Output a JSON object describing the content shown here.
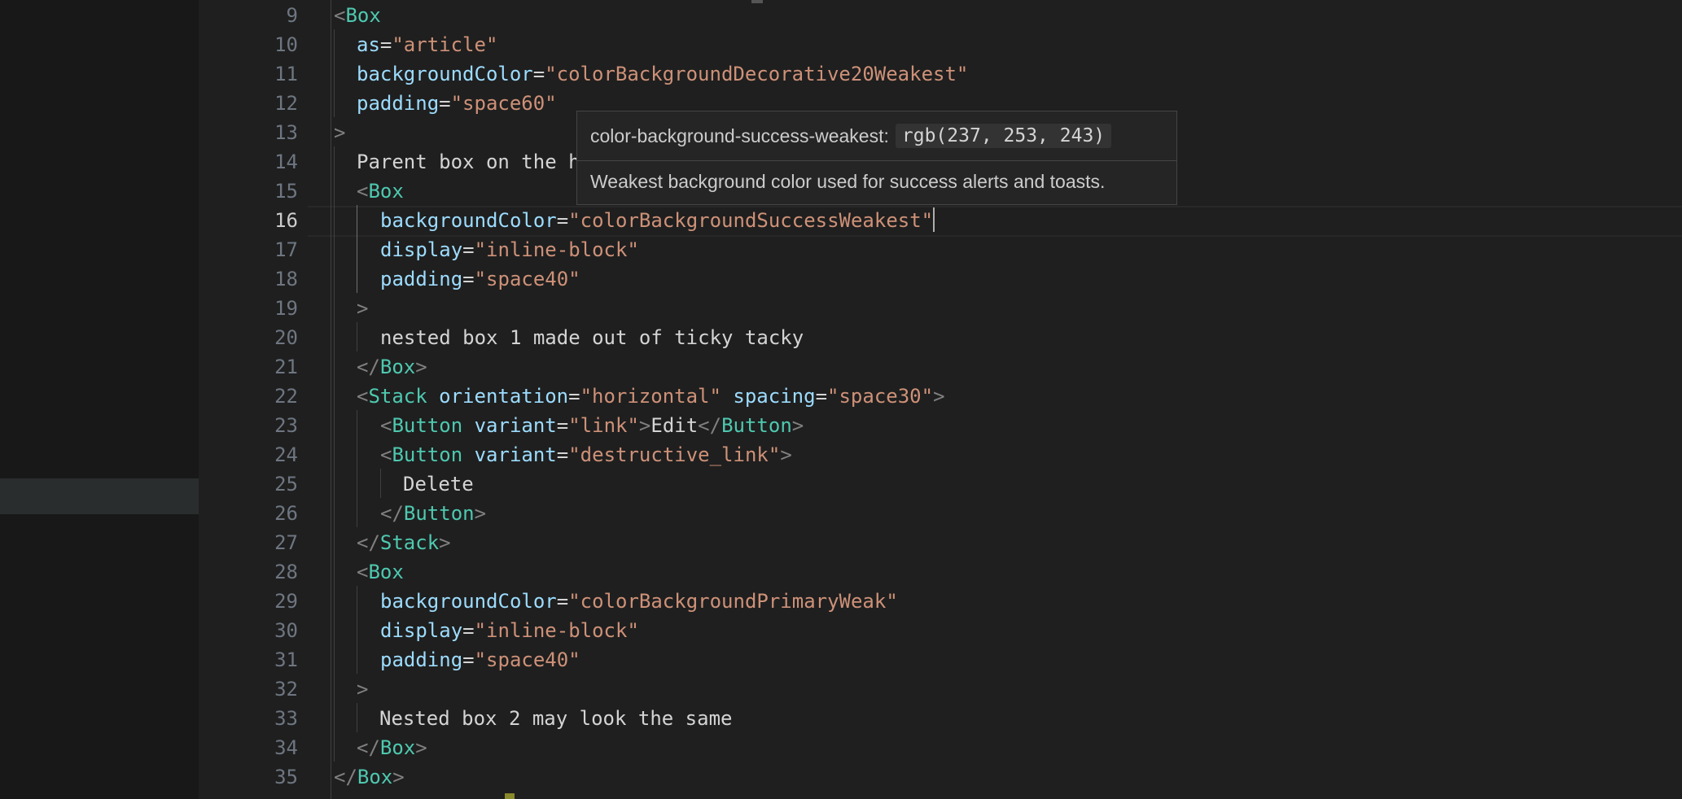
{
  "editor": {
    "line_numbers": [
      "9",
      "10",
      "11",
      "12",
      "13",
      "14",
      "15",
      "16",
      "17",
      "18",
      "19",
      "20",
      "21",
      "22",
      "23",
      "24",
      "25",
      "26",
      "27",
      "28",
      "29",
      "30",
      "31",
      "32",
      "33",
      "34",
      "35"
    ],
    "active_line": "16",
    "code": {
      "l9_tag": "Box",
      "l10_attr": "as",
      "l10_val": "\"article\"",
      "l11_attr": "backgroundColor",
      "l11_val": "\"colorBackgroundDecorative20Weakest\"",
      "l12_attr": "padding",
      "l12_val": "\"space60\"",
      "l14_text": "Parent box on the h",
      "l15_tag": "Box",
      "l16_attr": "backgroundColor",
      "l16_val": "\"colorBackgroundSuccessWeakest\"",
      "l17_attr": "display",
      "l17_val": "\"inline-block\"",
      "l18_attr": "padding",
      "l18_val": "\"space40\"",
      "l20_text": "nested box 1 made out of ticky tacky",
      "l21_tag": "Box",
      "l22_tag": "Stack",
      "l22_attr1": "orientation",
      "l22_val1": "\"horizontal\"",
      "l22_attr2": "spacing",
      "l22_val2": "\"space30\"",
      "l23_tag": "Button",
      "l23_attr": "variant",
      "l23_val": "\"link\"",
      "l23_text": "Edit",
      "l23_close": "Button",
      "l24_tag": "Button",
      "l24_attr": "variant",
      "l24_val": "\"destructive_link\"",
      "l25_text": "Delete",
      "l26_tag": "Button",
      "l27_tag": "Stack",
      "l28_tag": "Box",
      "l29_attr": "backgroundColor",
      "l29_val": "\"colorBackgroundPrimaryWeak\"",
      "l30_attr": "display",
      "l30_val": "\"inline-block\"",
      "l31_attr": "padding",
      "l31_val": "\"space40\"",
      "l33_text": "Nested box 2 may look the same",
      "l34_tag": "Box",
      "l35_tag": "Box"
    }
  },
  "hover": {
    "token_name": "color-background-success-weakest:",
    "token_value": "rgb(237, 253, 243)",
    "description": "Weakest background color used for success alerts and toasts."
  }
}
